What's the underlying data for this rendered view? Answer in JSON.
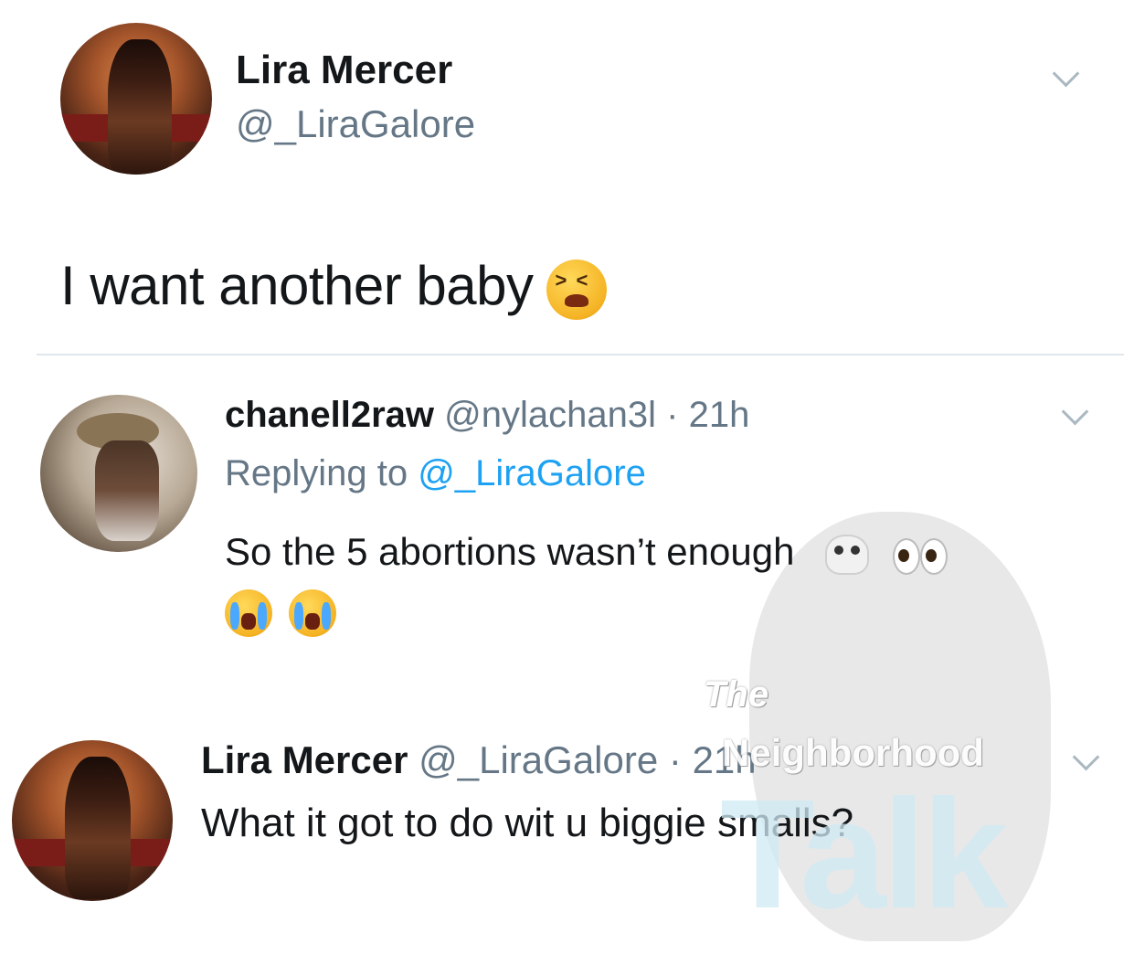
{
  "main_tweet": {
    "name": "Lira Mercer",
    "handle": "@_LiraGalore",
    "text": "I want another baby",
    "emoji": "tired-face"
  },
  "reply_1": {
    "name": "chanell2raw",
    "handle": "@nylachan3l",
    "separator": "·",
    "time": "21h",
    "replying_prefix": "Replying to",
    "replying_to": "@_LiraGalore",
    "text": "So the 5 abortions wasn’t enough",
    "emojis": [
      "skull",
      "eyes",
      "loudly-crying-face",
      "loudly-crying-face"
    ]
  },
  "reply_2": {
    "name": "Lira Mercer",
    "handle": "@_LiraGalore",
    "separator": "·",
    "time": "21h",
    "text": "What it got to do wit u biggie smalls?"
  },
  "watermark": {
    "line1": "The",
    "line2": "Neighborhood",
    "line3": "Talk"
  }
}
